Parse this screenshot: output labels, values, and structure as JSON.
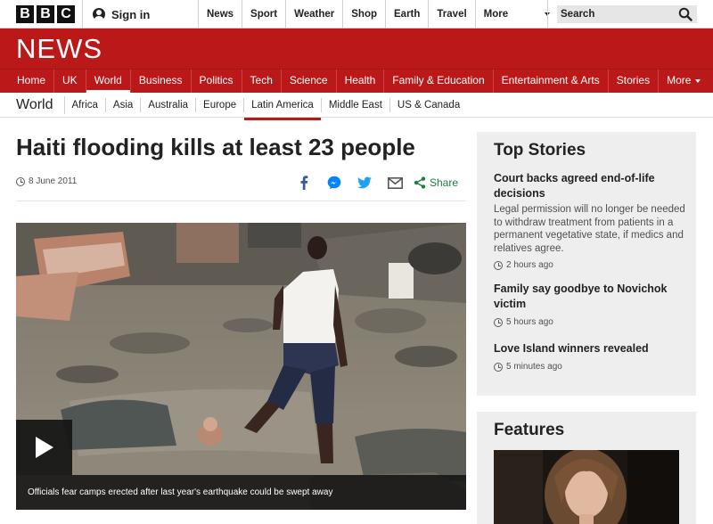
{
  "global_header": {
    "logo_letters": [
      "B",
      "B",
      "C"
    ],
    "sign_in": "Sign in",
    "nav": [
      "News",
      "Sport",
      "Weather",
      "Shop",
      "Earth",
      "Travel",
      "More"
    ],
    "search_placeholder": "Search"
  },
  "news_header": {
    "logo": "NEWS",
    "nav": [
      "Home",
      "UK",
      "World",
      "Business",
      "Politics",
      "Tech",
      "Science",
      "Health",
      "Family & Education",
      "Entertainment & Arts",
      "Stories",
      "More"
    ],
    "active": "World"
  },
  "section_nav": {
    "title": "World",
    "items": [
      "Africa",
      "Asia",
      "Australia",
      "Europe",
      "Latin America",
      "Middle East",
      "US & Canada"
    ],
    "active": "Latin America"
  },
  "article": {
    "headline": "Haiti flooding kills at least 23 people",
    "date": "8 June 2011",
    "share_label": "Share",
    "share_icons": [
      "facebook-icon",
      "messenger-icon",
      "twitter-icon",
      "email-icon",
      "share-icon"
    ],
    "media_caption": "Officials fear camps erected after last year's earthquake could be swept away"
  },
  "top_stories": {
    "title": "Top Stories",
    "stories": [
      {
        "headline": "Court backs agreed end-of-life decisions",
        "summary": "Legal permission will no longer be needed to withdraw treatment from patients in a permanent vegetative state, if medics and relatives agree.",
        "time": "2 hours ago"
      },
      {
        "headline": "Family say goodbye to Novichok victim",
        "time": "5 hours ago"
      },
      {
        "headline": "Love Island winners revealed",
        "time": "5 minutes ago"
      }
    ]
  },
  "features": {
    "title": "Features"
  },
  "colors": {
    "brand_red": "#bb1919",
    "share_green": "#1a7f3f",
    "sidebar_bg": "#eeeeee"
  }
}
